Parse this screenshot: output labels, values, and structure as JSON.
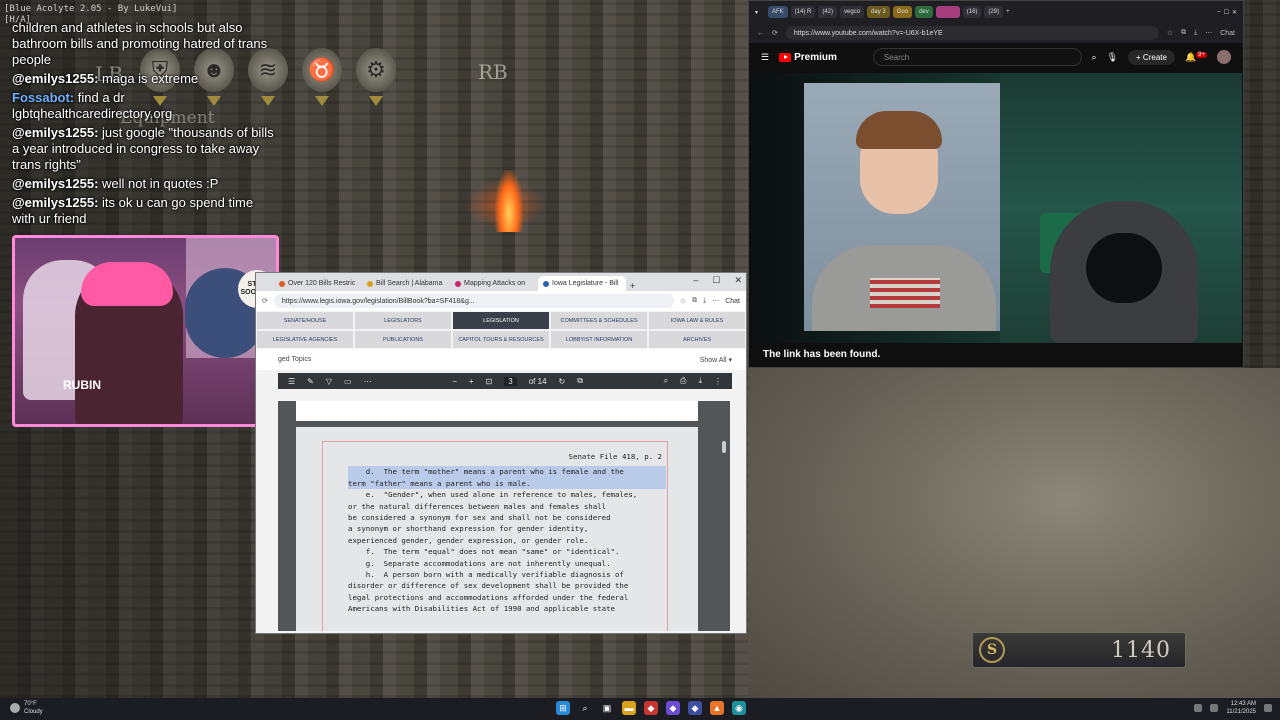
{
  "overlay": {
    "title": "[Blue Acolyte 2.05 - By LukeVui]",
    "subtitle": "[H/A]"
  },
  "hud": {
    "lb": "LB",
    "rb": "RB",
    "equipment": "Equipment"
  },
  "chat": {
    "messages": [
      {
        "user": "",
        "text": "children and athletes in schools but also bathroom bills and promoting hatred of trans people"
      },
      {
        "user": "@emilys1255:",
        "text": "maga is extreme"
      },
      {
        "user": "Fossabot:",
        "text": "find a dr lgbtqhealthcaredirectory.org"
      },
      {
        "user": "@emilys1255:",
        "text": "just google \"thousands of bills a year introduced in congress to take away trans rights\""
      },
      {
        "user": "@emilys1255:",
        "text": "well not in quotes :P"
      },
      {
        "user": "@emilys1255:",
        "text": "its ok u can go spend time with ur friend"
      }
    ]
  },
  "webcam": {
    "sign_text": "STOP SOONING",
    "shirt_text": "RUBIN"
  },
  "pdf_browser": {
    "tabs": [
      {
        "label": "Over 120 Bills Restric",
        "color": "#e05a2a"
      },
      {
        "label": "Bill Search | Alabama",
        "color": "#d9a01e"
      },
      {
        "label": "Mapping Attacks on",
        "color": "#c9246a"
      },
      {
        "label": "Iowa Legislature - Bill",
        "color": "#2b63b5"
      }
    ],
    "url": "https://www.legis.iowa.gov/legislation/BillBook?ba=SF418&g...",
    "chat_label": "Chat",
    "nav": [
      {
        "label": "SENATE/HOUSE"
      },
      {
        "label": "LEGISLATORS"
      },
      {
        "label": "LEGISLATION"
      },
      {
        "label": "COMMITTEES & SCHEDULES"
      },
      {
        "label": "IOWA LAW & RULES"
      },
      {
        "label": "LEGISLATIVE AGENCIES"
      },
      {
        "label": "PUBLICATIONS"
      },
      {
        "label": "CAPITOL TOURS & RESOURCES"
      },
      {
        "label": "LOBBYIST INFORMATION"
      },
      {
        "label": "ARCHIVES"
      }
    ],
    "topics_label": "ged Topics",
    "show_all": "Show All ▾",
    "page_current": "3",
    "page_total": "of 14",
    "doc": {
      "header": "Senate File 418, p. 2",
      "lines": [
        "    d.  The term \"mother\" means a parent who is female and the",
        "term \"father\" means a parent who is male.",
        "    e.  \"Gender\", when used alone in reference to males, females,",
        "or the natural differences between males and females shall",
        "be considered a synonym for sex and shall not be considered",
        "a synonym or shorthand expression for gender identity,",
        "experienced gender, gender expression, or gender role.",
        "    f.  The term \"equal\" does not mean \"same\" or \"identical\".",
        "    g.  Separate accommodations are not inherently unequal.",
        "    h.  A person born with a medically verifiable diagnosis of",
        "disorder or difference of sex development shall be provided the",
        "legal protections and accommodations afforded under the federal",
        "Americans with Disabilities Act of 1990 and applicable state"
      ]
    }
  },
  "yt_browser": {
    "tabs": [
      {
        "label": "AFK",
        "color": "#3a4a6a"
      },
      {
        "label": "(14) R",
        "color": "#2f2f35"
      },
      {
        "label": "(42)",
        "color": "#2f2f35"
      },
      {
        "label": "vegco",
        "color": "#2f2f35"
      },
      {
        "label": "day 3",
        "color": "#6b5a1e"
      },
      {
        "label": "Goo",
        "color": "#8a6a1a"
      },
      {
        "label": "dev",
        "color": "#2c6b3e"
      },
      {
        "label": "",
        "color": "#a43c7d"
      },
      {
        "label": "(16)",
        "color": "#2f2f35"
      },
      {
        "label": "(29)",
        "color": "#2f2f35"
      }
    ],
    "url": "https://www.youtube.com/watch?v=-U6X-b1eYE",
    "chat_label": "Chat",
    "brand": "Premium",
    "search_placeholder": "Search",
    "create_label": "+ Create",
    "notif_count": "9+",
    "caption": "The link has been found."
  },
  "score": {
    "value": "1140"
  },
  "taskbar": {
    "weather_temp": "70°F",
    "weather_desc": "Cloudy",
    "time": "12:43 AM",
    "date": "11/21/2025"
  },
  "colors": {
    "webcam_border": "#ff8ad8",
    "youtube_red": "#ff0000",
    "fossabot": "#6fb1ff"
  }
}
